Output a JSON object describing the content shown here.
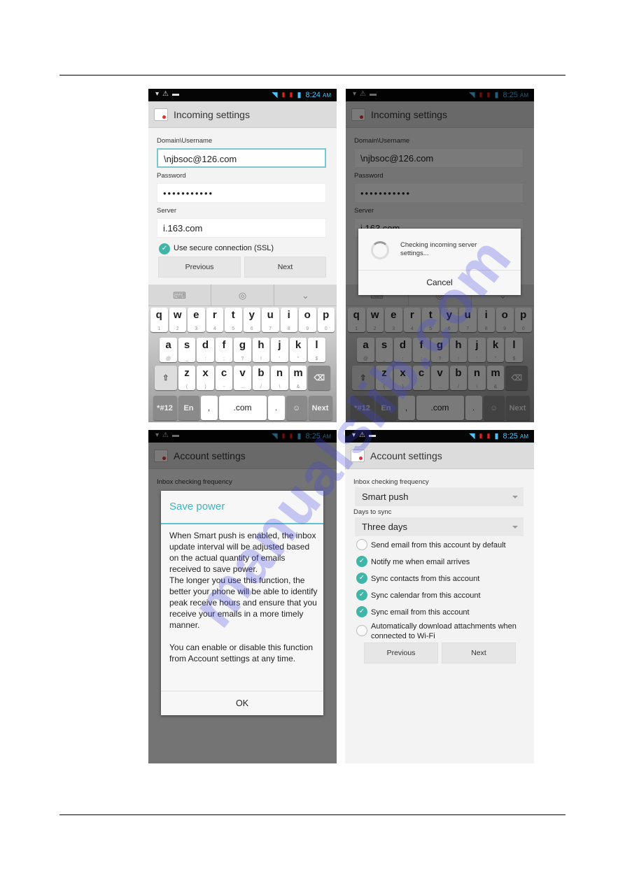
{
  "status": {
    "time_1": "8:24",
    "time_2": "8:25",
    "ampm": "AM"
  },
  "incoming": {
    "title": "Incoming settings",
    "domain_label": "Domain\\Username",
    "domain_value": "\\njbsoc@126.com",
    "password_label": "Password",
    "password_value": "•••••••••••",
    "server_label": "Server",
    "server_value": "i.163.com",
    "ssl_label": "Use secure connection (SSL)",
    "ssl_checked": true,
    "previous": "Previous",
    "next": "Next"
  },
  "keyboard": {
    "toolbar": [
      "keyboard-icon",
      "globe-icon",
      "chevron-down-icon"
    ],
    "row1": [
      [
        "q",
        "1"
      ],
      [
        "w",
        "2"
      ],
      [
        "e",
        "3"
      ],
      [
        "r",
        "4"
      ],
      [
        "t",
        "5"
      ],
      [
        "y",
        "6"
      ],
      [
        "u",
        "7"
      ],
      [
        "i",
        "8"
      ],
      [
        "o",
        "9"
      ],
      [
        "p",
        "0"
      ]
    ],
    "row2": [
      [
        "a",
        "@"
      ],
      [
        "s",
        "_"
      ],
      [
        "d",
        ":"
      ],
      [
        "f",
        ";"
      ],
      [
        "g",
        "?"
      ],
      [
        "h",
        "!"
      ],
      [
        "j",
        "'"
      ],
      [
        "k",
        "\""
      ],
      [
        "l",
        "$"
      ]
    ],
    "row3": [
      [
        "z",
        "("
      ],
      [
        "x",
        ")"
      ],
      [
        "c",
        "-"
      ],
      [
        "v",
        "…"
      ],
      [
        "b",
        "/"
      ],
      [
        "n",
        "\\"
      ],
      [
        "m",
        "&"
      ]
    ],
    "row4": [
      "*#12",
      "En",
      ",",
      ".com",
      ".",
      "☺",
      "Next"
    ]
  },
  "checking_dialog": {
    "message": "Checking incoming server settings...",
    "cancel": "Cancel"
  },
  "account": {
    "title": "Account settings",
    "frequency_label": "Inbox checking frequency",
    "frequency_value": "Smart push",
    "days_label": "Days to sync",
    "days_value": "Three days",
    "options": [
      {
        "label": "Send email from this account by default",
        "checked": false
      },
      {
        "label": "Notify me when email arrives",
        "checked": true
      },
      {
        "label": "Sync contacts from this account",
        "checked": true
      },
      {
        "label": "Sync calendar from this account",
        "checked": true
      },
      {
        "label": "Sync email from this account",
        "checked": true
      },
      {
        "label": "Automatically download attachments when connected to Wi-Fi",
        "checked": false
      }
    ],
    "previous": "Previous",
    "next": "Next"
  },
  "save_power_dialog": {
    "title": "Save power",
    "body_1": "When Smart push is enabled, the inbox update interval will be adjusted based on the actual quantity of emails received to save power.",
    "body_2": "The longer you use this function, the better your phone will be able to identify peak receive hours and ensure that you receive your emails in a more timely manner.",
    "body_3": "You can enable or disable this function from Account settings at any time.",
    "ok": "OK"
  },
  "accent_color": "#3fb6a8",
  "watermark": "manualslib.com"
}
